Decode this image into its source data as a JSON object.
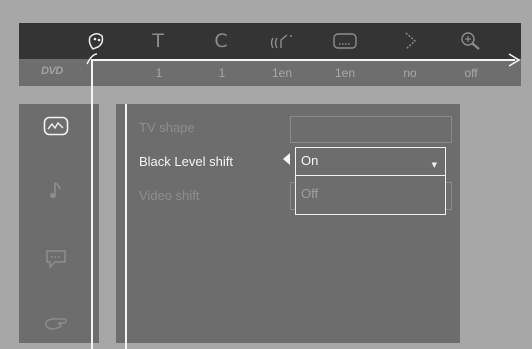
{
  "top_bar": {
    "icons": [
      {
        "name": "picture-settings-icon",
        "active": true
      },
      {
        "name": "title-icon",
        "glyph": "T"
      },
      {
        "name": "chapter-icon",
        "glyph": "C"
      },
      {
        "name": "audio-language-icon"
      },
      {
        "name": "subtitle-icon"
      },
      {
        "name": "angle-icon"
      },
      {
        "name": "zoom-icon"
      }
    ]
  },
  "value_bar": {
    "logo": "DVD",
    "values": [
      "1",
      "1",
      "1en",
      "1en",
      "no",
      "off"
    ]
  },
  "left_menu": {
    "items": [
      {
        "name": "picture-menu-icon",
        "active": true
      },
      {
        "name": "sound-menu-icon"
      },
      {
        "name": "language-menu-icon"
      },
      {
        "name": "features-menu-icon"
      }
    ]
  },
  "main_menu": {
    "rows": [
      {
        "label": "TV shape"
      },
      {
        "label": "Black Level shift",
        "selected": true
      },
      {
        "label": "Video shift"
      }
    ],
    "dropdown": {
      "options": [
        "On",
        "Off"
      ],
      "selected": "On"
    }
  },
  "colors": {
    "background": "#a7a7a7",
    "top_bar": "#343434",
    "value_bar": "#6e6e6e",
    "panel": "#6d6d6d",
    "highlight": "#f4f4f4"
  }
}
